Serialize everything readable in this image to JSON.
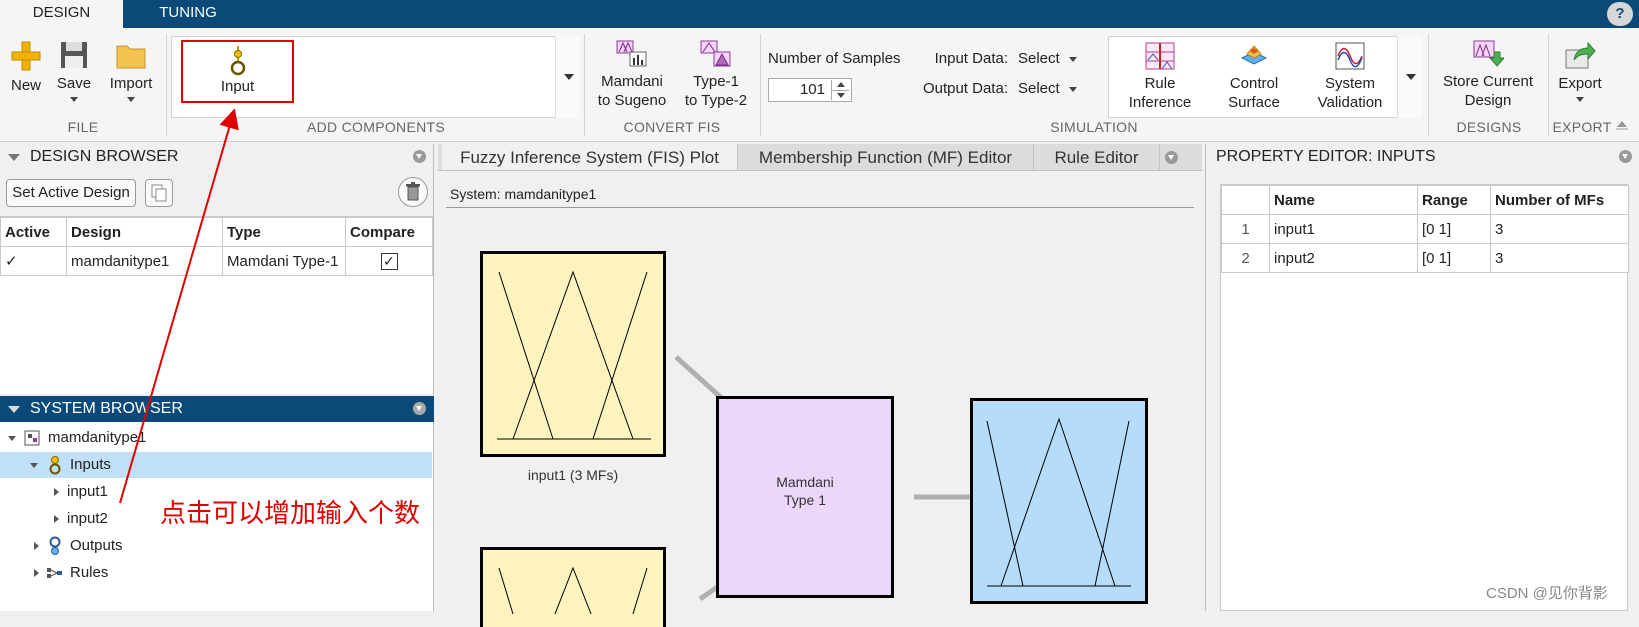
{
  "top_tabs": {
    "design": "DESIGN",
    "tuning": "TUNING",
    "help": "?"
  },
  "ribbon": {
    "file": {
      "group_label": "FILE",
      "new": "New",
      "save": "Save",
      "import": "Import"
    },
    "add_components": {
      "group_label": "ADD COMPONENTS",
      "input": "Input"
    },
    "convert_fis": {
      "group_label": "CONVERT FIS",
      "mamdani_to_sugeno_line1": "Mamdani",
      "mamdani_to_sugeno_line2": "to Sugeno",
      "type1_to_type2_line1": "Type-1",
      "type1_to_type2_line2": "to Type-2"
    },
    "simulation": {
      "group_label": "SIMULATION",
      "num_samples_label": "Number of Samples",
      "num_samples_value": "101",
      "input_data_label": "Input Data:",
      "input_data_value": "Select",
      "output_data_label": "Output Data:",
      "output_data_value": "Select",
      "rule_inference_line1": "Rule",
      "rule_inference_line2": "Inference",
      "control_surface_line1": "Control",
      "control_surface_line2": "Surface",
      "system_validation_line1": "System",
      "system_validation_line2": "Validation"
    },
    "designs": {
      "group_label": "DESIGNS",
      "store_line1": "Store Current",
      "store_line2": "Design"
    },
    "export": {
      "group_label": "EXPORT",
      "export": "Export"
    }
  },
  "design_browser": {
    "title": "DESIGN BROWSER",
    "set_active_button": "Set Active Design",
    "columns": [
      "Active",
      "Design",
      "Type",
      "Compare"
    ],
    "rows": [
      {
        "active": "✓",
        "design": "mamdanitype1",
        "type": "Mamdani Type-1",
        "compare": "✓"
      }
    ]
  },
  "system_browser": {
    "title": "SYSTEM BROWSER",
    "root": "mamdanitype1",
    "inputs": "Inputs",
    "input1": "input1",
    "input2": "input2",
    "outputs": "Outputs",
    "rules": "Rules"
  },
  "doc_tabs": {
    "fis_plot": "Fuzzy Inference System (FIS) Plot",
    "mf_editor": "Membership Function (MF) Editor",
    "rule_editor": "Rule Editor"
  },
  "fis_plot": {
    "system_label": "System: mamdanitype1",
    "input1_caption": "input1 (3 MFs)",
    "fis_line1": "Mamdani",
    "fis_line2": "Type 1"
  },
  "property_editor": {
    "title": "PROPERTY EDITOR: INPUTS",
    "columns": [
      "",
      "Name",
      "Range",
      "Number of MFs"
    ],
    "rows": [
      {
        "idx": "1",
        "name": "input1",
        "range": "[0 1]",
        "num_mfs": "3"
      },
      {
        "idx": "2",
        "name": "input2",
        "range": "[0 1]",
        "num_mfs": "3"
      }
    ]
  },
  "annotation": {
    "text": "点击可以增加输入个数",
    "color": "#e00000"
  },
  "watermark": "CSDN @见你背影",
  "colors": {
    "accent": "#0b4a78",
    "input_mf": "#fdf3bf",
    "output_mf": "#b5dcfb",
    "fis_box": "#ecd7fb",
    "selected_row": "#bfe0f7"
  }
}
